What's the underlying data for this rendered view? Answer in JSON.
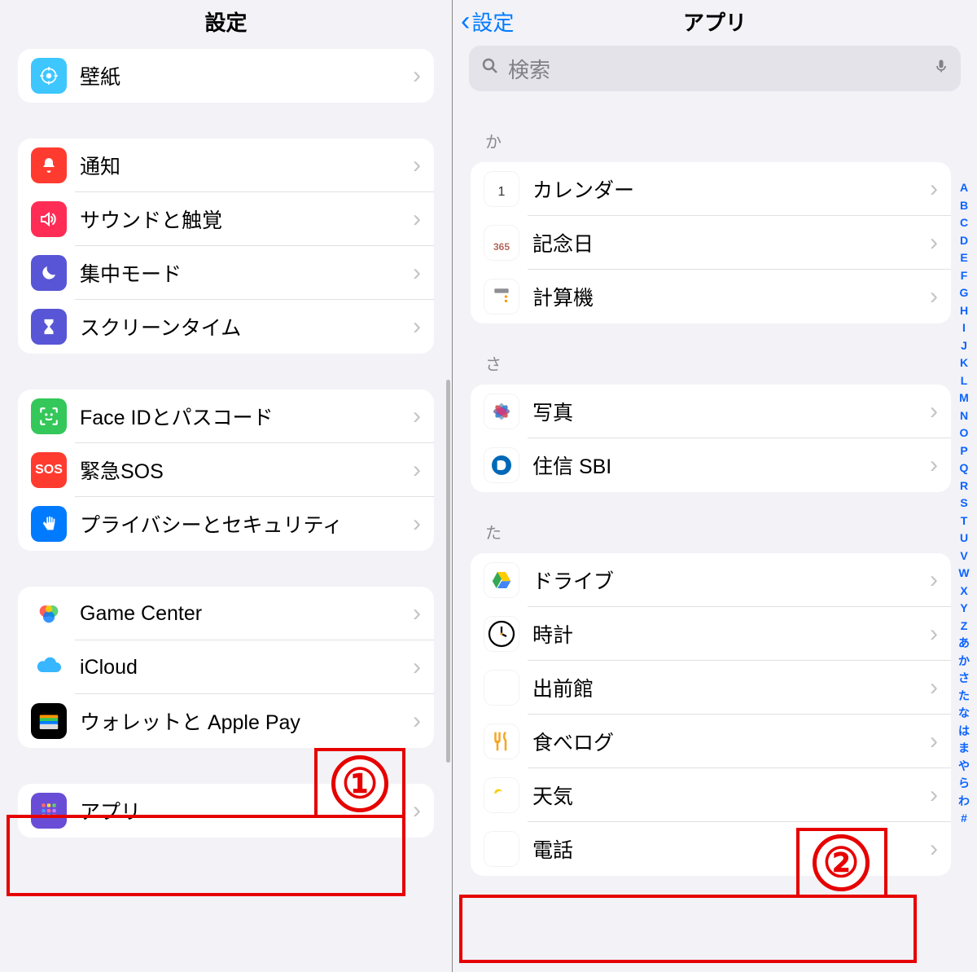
{
  "left": {
    "header_title": "設定",
    "groups": [
      {
        "rows": [
          {
            "icon": "wallpaper-icon",
            "label": "壁紙"
          }
        ]
      },
      {
        "rows": [
          {
            "icon": "bell-icon",
            "label": "通知"
          },
          {
            "icon": "speaker-icon",
            "label": "サウンドと触覚"
          },
          {
            "icon": "moon-icon",
            "label": "集中モード"
          },
          {
            "icon": "hourglass-icon",
            "label": "スクリーンタイム"
          }
        ]
      },
      {
        "rows": [
          {
            "icon": "faceid-icon",
            "label": "Face IDとパスコード"
          },
          {
            "icon": "sos-icon",
            "label": "緊急SOS"
          },
          {
            "icon": "hand-icon",
            "label": "プライバシーとセキュリティ"
          }
        ]
      },
      {
        "rows": [
          {
            "icon": "gamecenter-icon",
            "label": "Game Center"
          },
          {
            "icon": "icloud-icon",
            "label": "iCloud"
          },
          {
            "icon": "wallet-icon",
            "label": "ウォレットと Apple Pay"
          }
        ]
      },
      {
        "rows": [
          {
            "icon": "apps-grid-icon",
            "label": "アプリ"
          }
        ]
      }
    ],
    "annotation": "①"
  },
  "right": {
    "back_label": "設定",
    "header_title": "アプリ",
    "search_placeholder": "検索",
    "sections": [
      {
        "label": "か",
        "rows": [
          {
            "icon": "calendar-icon",
            "label": "カレンダー"
          },
          {
            "icon": "reminder365-icon",
            "label": "記念日"
          },
          {
            "icon": "calculator-icon",
            "label": "計算機"
          }
        ]
      },
      {
        "label": "さ",
        "rows": [
          {
            "icon": "photos-icon",
            "label": "写真"
          },
          {
            "icon": "sbi-icon",
            "label": "住信 SBI"
          }
        ]
      },
      {
        "label": "た",
        "rows": [
          {
            "icon": "drive-icon",
            "label": "ドライブ"
          },
          {
            "icon": "clock-icon",
            "label": "時計"
          },
          {
            "icon": "demae-icon",
            "label": "出前館"
          },
          {
            "icon": "tabelog-icon",
            "label": "食べログ"
          },
          {
            "icon": "weather-icon",
            "label": "天気"
          },
          {
            "icon": "phone-icon",
            "label": "電話"
          }
        ]
      }
    ],
    "index": [
      "A",
      "B",
      "C",
      "D",
      "E",
      "F",
      "G",
      "H",
      "I",
      "J",
      "K",
      "L",
      "M",
      "N",
      "O",
      "P",
      "Q",
      "R",
      "S",
      "T",
      "U",
      "V",
      "W",
      "X",
      "Y",
      "Z",
      "あ",
      "か",
      "さ",
      "た",
      "な",
      "は",
      "ま",
      "や",
      "ら",
      "わ",
      "#"
    ],
    "annotation": "②"
  }
}
